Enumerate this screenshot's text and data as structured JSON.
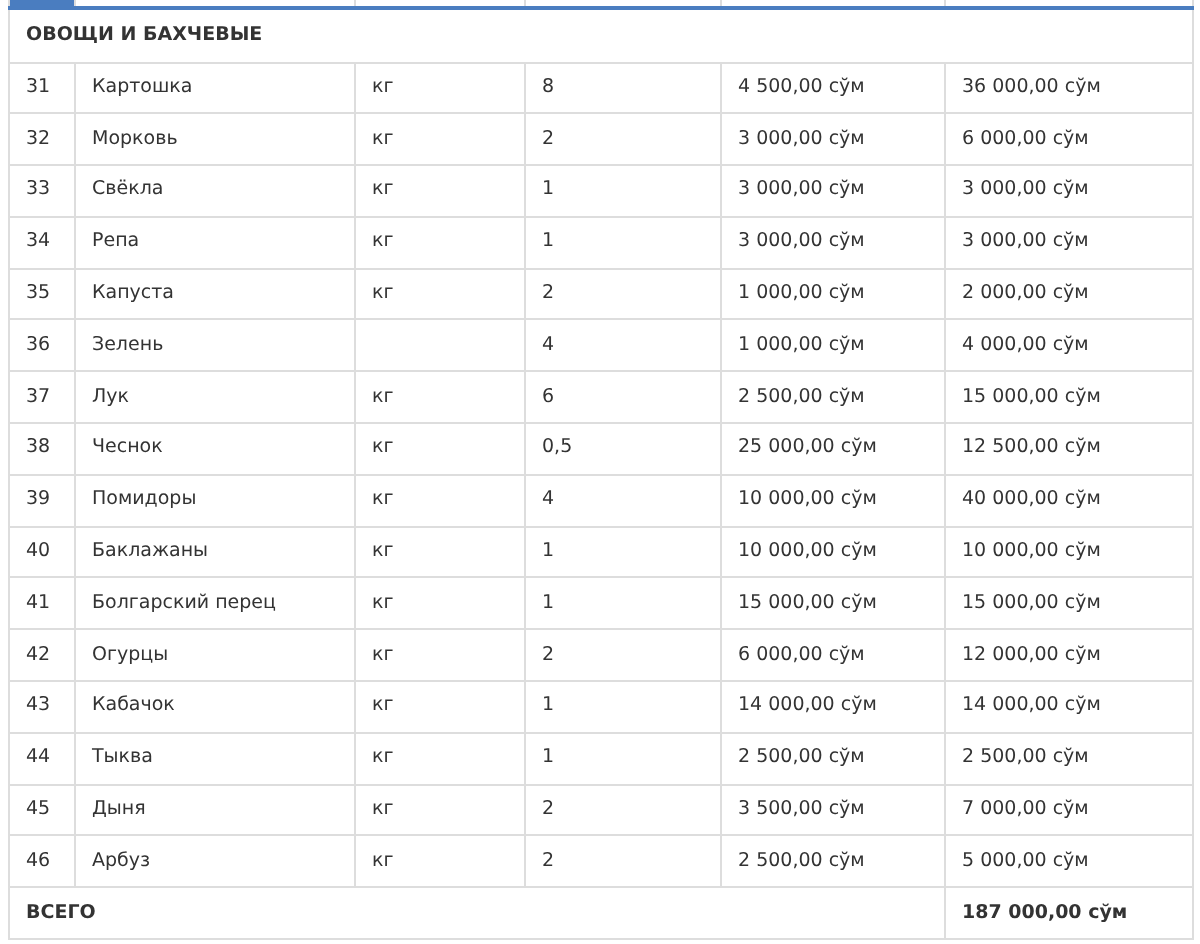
{
  "section": {
    "title": "ОВОЩИ И БАХЧЕВЫЕ"
  },
  "rows": [
    {
      "num": "31",
      "name": "Картошка",
      "unit": "кг",
      "qty": "8",
      "price": "4 500,00 сўм",
      "sum": "36 000,00 сўм"
    },
    {
      "num": "32",
      "name": "Морковь",
      "unit": "кг",
      "qty": "2",
      "price": "3 000,00 сўм",
      "sum": "6 000,00 сўм"
    },
    {
      "num": "33",
      "name": "Свёкла",
      "unit": "кг",
      "qty": "1",
      "price": "3 000,00 сўм",
      "sum": "3 000,00 сўм"
    },
    {
      "num": "34",
      "name": "Репа",
      "unit": "кг",
      "qty": "1",
      "price": "3 000,00 сўм",
      "sum": "3 000,00 сўм"
    },
    {
      "num": "35",
      "name": "Капуста",
      "unit": "кг",
      "qty": "2",
      "price": "1 000,00 сўм",
      "sum": "2 000,00 сўм"
    },
    {
      "num": "36",
      "name": "Зелень",
      "qty": "4",
      "price": "1 000,00 сўм",
      "sum": "4 000,00 сўм"
    },
    {
      "num": "37",
      "name": "Лук",
      "unit": "кг",
      "qty": "6",
      "price": "2 500,00 сўм",
      "sum": "15 000,00 сўм"
    },
    {
      "num": "38",
      "name": "Чеснок",
      "unit": "кг",
      "qty": "0,5",
      "price": "25 000,00 сўм",
      "sum": "12 500,00 сўм"
    },
    {
      "num": "39",
      "name": "Помидоры",
      "unit": "кг",
      "qty": "4",
      "price": "10 000,00 сўм",
      "sum": "40 000,00 сўм"
    },
    {
      "num": "40",
      "name": "Баклажаны",
      "unit": "кг",
      "qty": "1",
      "price": "10 000,00 сўм",
      "sum": "10 000,00 сўм"
    },
    {
      "num": "41",
      "name": "Болгарский перец",
      "unit": "кг",
      "qty": "1",
      "price": "15 000,00 сўм",
      "sum": "15 000,00 сўм"
    },
    {
      "num": "42",
      "name": "Огурцы",
      "unit": "кг",
      "qty": "2",
      "price": "6 000,00 сўм",
      "sum": "12 000,00 сўм"
    },
    {
      "num": "43",
      "name": "Кабачок",
      "unit": "кг",
      "qty": "1",
      "price": "14 000,00 сўм",
      "sum": "14 000,00 сўм"
    },
    {
      "num": "44",
      "name": "Тыква",
      "unit": "кг",
      "qty": "1",
      "price": "2 500,00 сўм",
      "sum": "2 500,00 сўм"
    },
    {
      "num": "45",
      "name": "Дыня",
      "unit": "кг",
      "qty": "2",
      "price": "3 500,00 сўм",
      "sum": "7 000,00 сўм"
    },
    {
      "num": "46",
      "name": "Арбуз",
      "unit": "кг",
      "qty": "2",
      "price": "2 500,00 сўм",
      "sum": "5 000,00 сўм"
    }
  ],
  "total": {
    "label": "ВСЕГО",
    "value": "187 000,00 сўм"
  }
}
